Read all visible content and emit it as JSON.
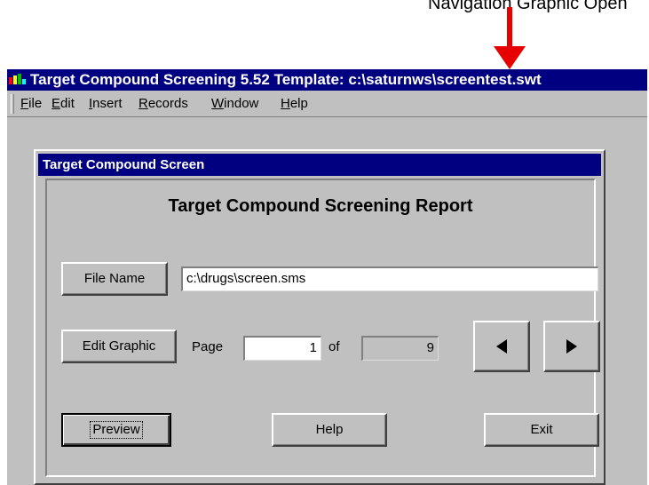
{
  "annotation": {
    "top_text": "Navigation Graphic Open",
    "arrow_color": "#e60000"
  },
  "window": {
    "title": "Target Compound Screening 5.52 Template: c:\\saturnws\\screentest.swt",
    "icon": "app-icon",
    "titlebar_color": "#000080",
    "face_color": "#c0c0c0"
  },
  "menu": {
    "items": [
      {
        "accel": "F",
        "rest": "ile"
      },
      {
        "accel": "E",
        "rest": "dit"
      },
      {
        "accel": "I",
        "rest": "nsert"
      },
      {
        "accel": "R",
        "rest": "ecords"
      },
      {
        "accel": "W",
        "rest": "indow"
      },
      {
        "accel": "H",
        "rest": "elp"
      }
    ]
  },
  "dialog": {
    "title": "Target Compound Screen",
    "heading": "Target Compound Screening Report",
    "file_name_button": "File Name",
    "file_name_value": "c:\\drugs\\screen.sms",
    "edit_graphic_button": "Edit Graphic",
    "page_label": "Page",
    "page_value": "1",
    "of_label": "of",
    "total_pages": "9",
    "prev_icon": "triangle-left-icon",
    "next_icon": "triangle-right-icon",
    "preview_button": "Preview",
    "help_button": "Help",
    "exit_button": "Exit"
  }
}
